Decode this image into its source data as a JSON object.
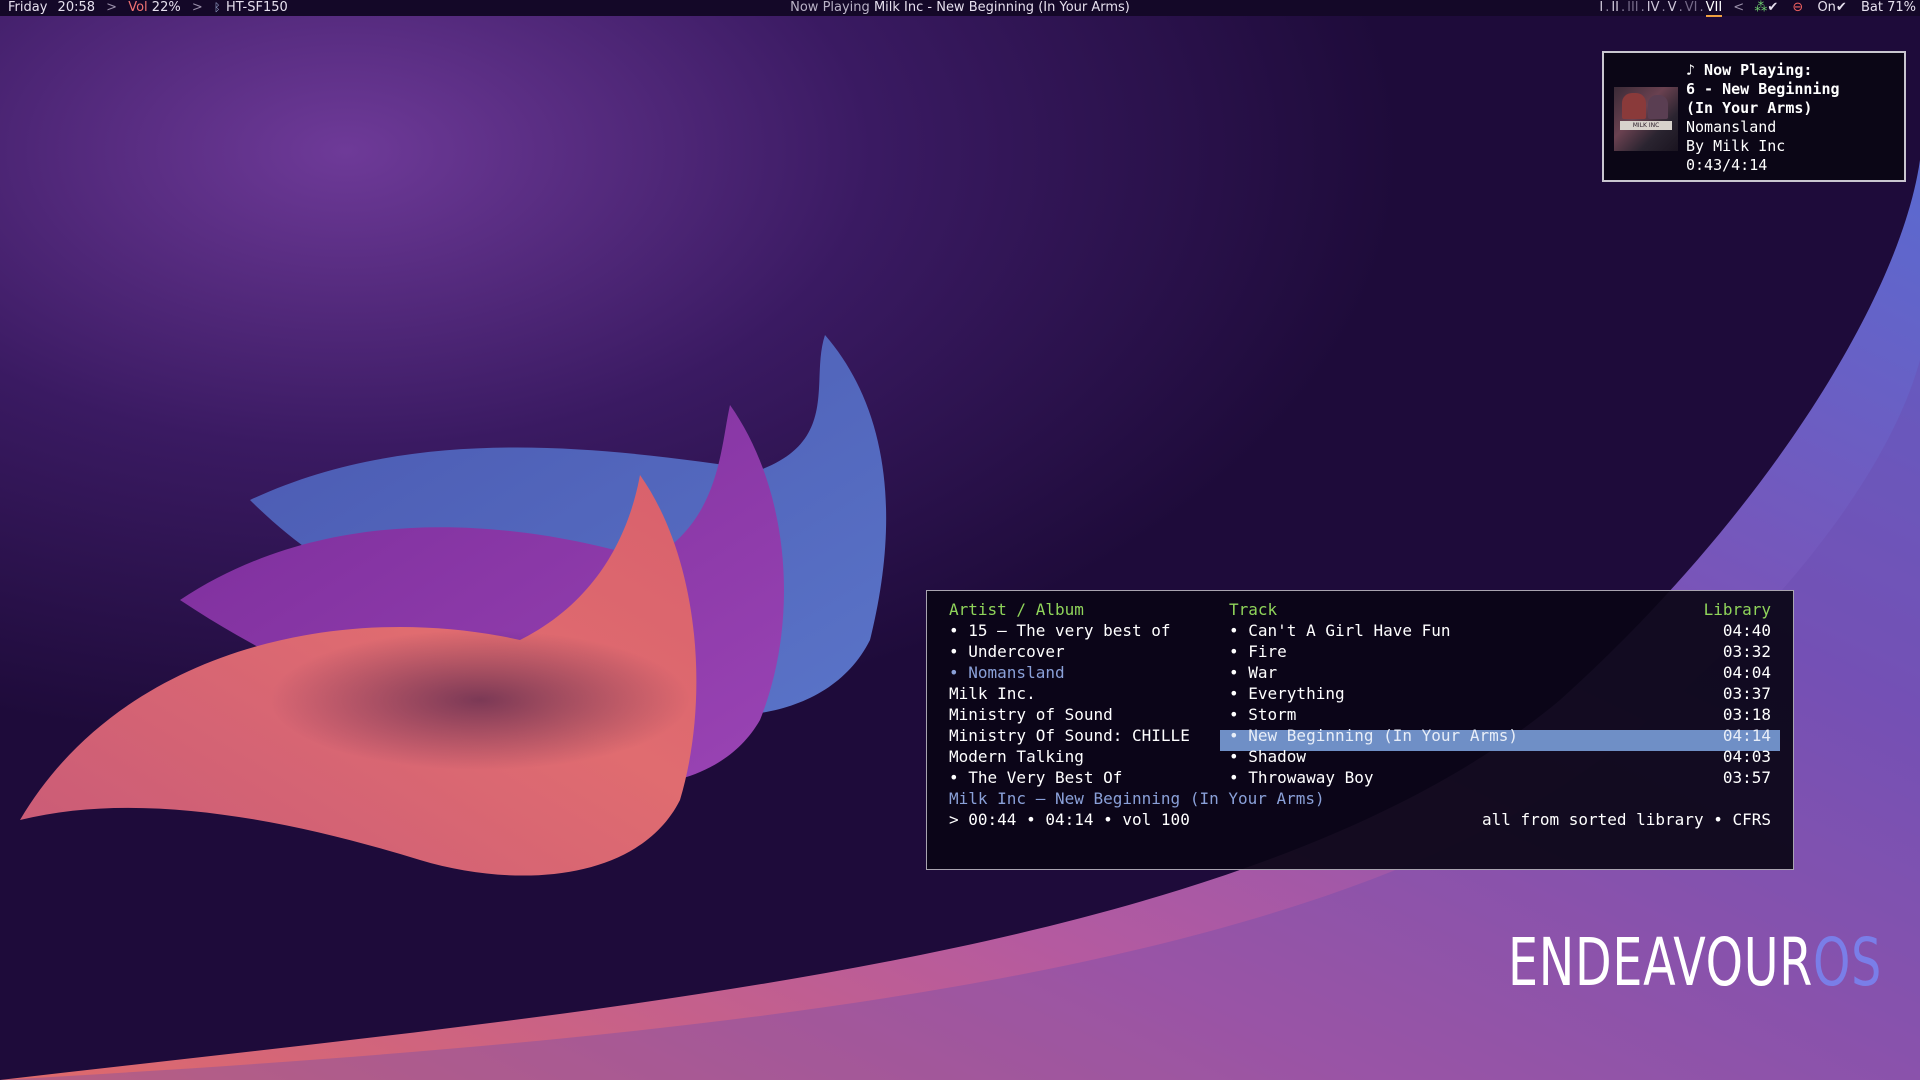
{
  "topbar": {
    "day": "Friday",
    "time": "20:58",
    "sep": ">",
    "volume_label": "Vol",
    "volume_value": "22%",
    "bt_device": "HT-SF150",
    "now_playing_label": "Now Playing",
    "now_playing_value": "Milk Inc - New Beginning (In Your Arms)",
    "workspaces": [
      {
        "label": "I",
        "state": "normal"
      },
      {
        "label": "II",
        "state": "normal"
      },
      {
        "label": "III",
        "state": "dim"
      },
      {
        "label": "IV",
        "state": "normal"
      },
      {
        "label": "V",
        "state": "normal"
      },
      {
        "label": "VI",
        "state": "dim"
      },
      {
        "label": "VII",
        "state": "active"
      }
    ],
    "workspace_dot": ".",
    "arrow": "<",
    "net_check": "✔",
    "vpn_status": "On",
    "vpn_check": "✔",
    "battery_label": "Bat",
    "battery_value": "71%"
  },
  "notification": {
    "line1": "♪ Now Playing:",
    "line2": "6 - New Beginning",
    "line3": "(In Your Arms)",
    "line4": "Nomansland",
    "line5": "By Milk Inc",
    "line6": "0:43/4:14",
    "art_text": "MILK INC"
  },
  "player": {
    "header_left": "Artist / Album",
    "header_track": "Track",
    "header_right": "Library",
    "artists": [
      "• 15 – The very best of",
      "• Undercover",
      "• Nomansland",
      "Milk Inc.",
      "Ministry of Sound",
      "Ministry Of Sound: CHILLE",
      "Modern Talking",
      "• The Very Best Of"
    ],
    "tracks": [
      {
        "title": "• Can't A Girl Have Fun",
        "duration": "04:40"
      },
      {
        "title": "• Fire",
        "duration": "03:32"
      },
      {
        "title": "• War",
        "duration": "04:04"
      },
      {
        "title": "• Everything",
        "duration": "03:37"
      },
      {
        "title": "• Storm",
        "duration": "03:18"
      },
      {
        "title": "• New Beginning (In Your Arms)",
        "duration": "04:14"
      },
      {
        "title": "• Shadow",
        "duration": "04:03"
      },
      {
        "title": "• Throwaway Boy",
        "duration": "03:57"
      }
    ],
    "selected_index": 5,
    "playing_album_index": 2,
    "status_track": "Milk Inc – New Beginning (In Your Arms)",
    "status_progress": "> 00:44 • 04:14 • vol 100",
    "status_mode": "all from sorted library • CFRS"
  },
  "logo": {
    "main": "ENDEAVOUR",
    "accent": "OS"
  },
  "colors": {
    "bg_deep": "#1e0b3a",
    "wave_blue": "#5468b8",
    "wave_purple": "#8a3aa8",
    "wave_coral": "#e07070",
    "header_green": "#8fd45a",
    "highlight_blue": "#6f8fc6",
    "accent_blue": "#8aa0d8"
  }
}
